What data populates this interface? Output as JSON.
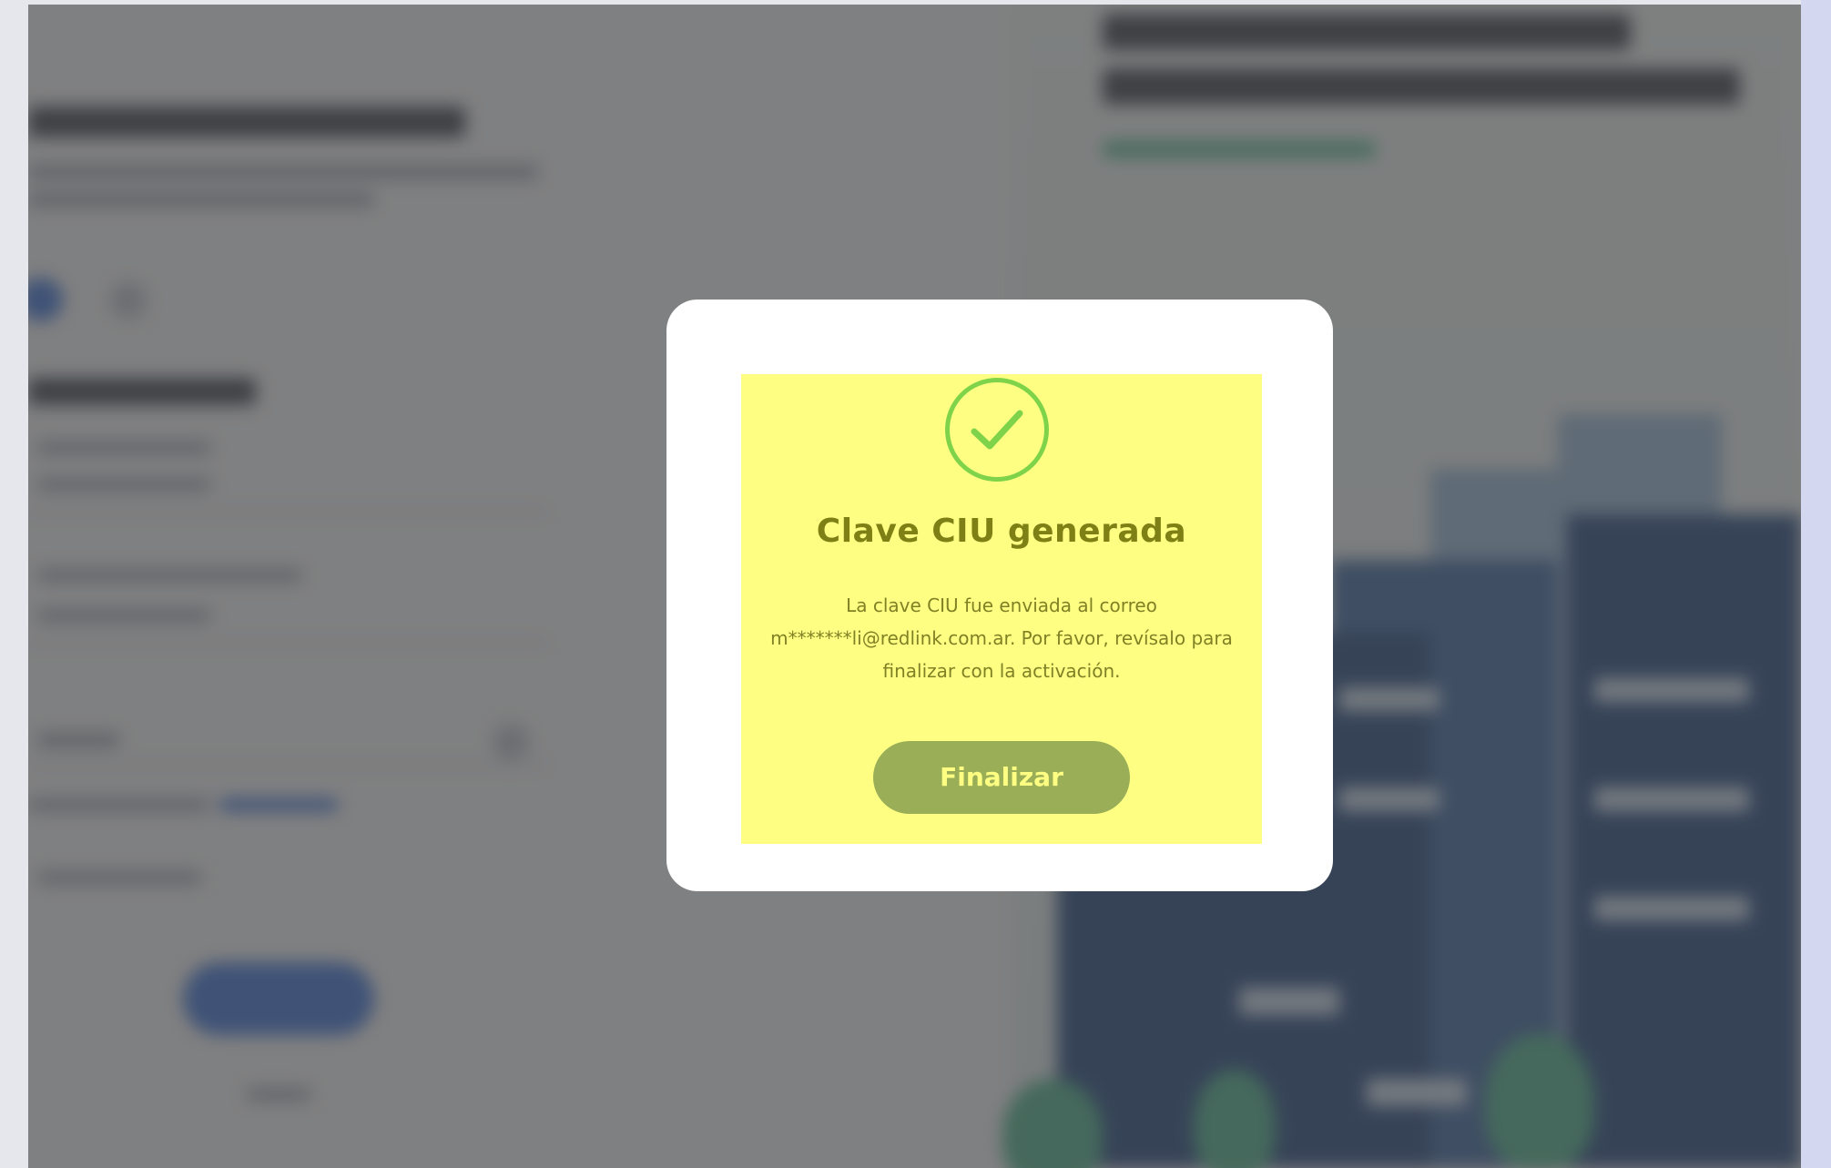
{
  "modal": {
    "icon": "check-circle-icon",
    "title": "Clave CIU generada",
    "message_line1": "La clave CIU fue enviada al correo",
    "message_line2": "m*******li@redlink.com.ar. Por favor, revísalo para",
    "message_line3": "finalizar con la activación.",
    "button_label": "Finalizar"
  },
  "colors": {
    "overlay": "#484848",
    "modal_background": "#ffffff",
    "content_highlight": "#feff82",
    "check_green": "#7fd34a",
    "title_color": "#7e7f15",
    "button_background": "#9aae58",
    "button_text": "#feff82"
  }
}
